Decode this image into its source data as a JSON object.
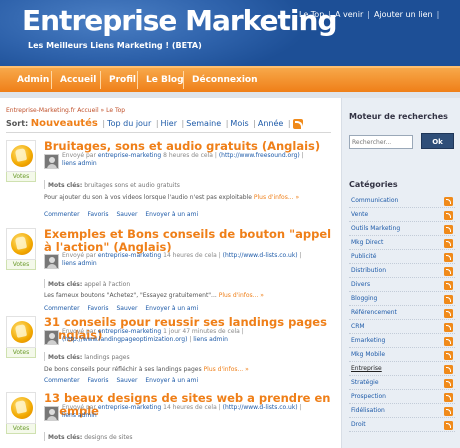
{
  "header": {
    "site_title": "Entreprise Marketing",
    "tagline": "Les Meilleurs Liens Marketing ! (BETA)",
    "top_links": [
      "Le Top",
      "A venir",
      "Ajouter un lien"
    ]
  },
  "nav": {
    "items": [
      "Admin",
      "Accueil",
      "Profil",
      "Le Blog",
      "Déconnexion"
    ]
  },
  "breadcrumb": {
    "home": "Entreprise-Marketing.fr Accueil",
    "sep": "»",
    "current": "Le Top"
  },
  "sort": {
    "label": "Sort:",
    "active": "Nouveautés",
    "options": [
      "Top du jour",
      "Hier",
      "Semaine",
      "Mois",
      "Année"
    ]
  },
  "stories": [
    {
      "title": "Bruitages, sons et audio gratuits (Anglais)",
      "vote_label": "Votes",
      "meta_line1_prefix": "Envoyé par",
      "meta_user": "entreprise-marketing",
      "meta_time": "8 heures de cela",
      "meta_url": "(http://www.freesound.org)",
      "meta_admin": "liens admin",
      "tags_label": "Mots clés:",
      "tags": "bruitages sons et audio gratuits",
      "desc": "Pour ajouter du son à vos videos lorsque l'audio n'est pas exploitable",
      "more": "Plus d'infos... »",
      "actions": [
        "Commenter",
        "Favoris",
        "Sauver",
        "Envoyer à un ami"
      ]
    },
    {
      "title": "Exemples et Bons conseils de bouton \"appel à l'action\" (Anglais)",
      "vote_label": "Votes",
      "meta_line1_prefix": "Envoyé par",
      "meta_user": "entreprise-marketing",
      "meta_time": "14 heures de cela",
      "meta_url": "(http://www.d-lists.co.uk)",
      "meta_admin": "liens admin",
      "tags_label": "Mots clés:",
      "tags": "appel à l'action",
      "desc": "Les fameux boutons \"Achetez\", \"Essayez gratuitement\"...",
      "more": "Plus d'infos... »",
      "actions": [
        "Commenter",
        "Favoris",
        "Sauver",
        "Envoyer à un ami"
      ]
    },
    {
      "title": "31 conseils pour reussir ses landings pages (Anglais)",
      "vote_label": "Votes",
      "meta_line1_prefix": "Envoyé par",
      "meta_user": "entreprise-marketing",
      "meta_time": "1 jour 47 minutes de cela",
      "meta_url": "(http://www.landingpageoptimization.org)",
      "meta_admin": "liens admin",
      "tags_label": "Mots clés:",
      "tags": "landings pages",
      "desc": "De bons conseils pour réfléchir à ses landings pages",
      "more": "Plus d'infos... »",
      "actions": [
        "Commenter",
        "Favoris",
        "Sauver",
        "Envoyer à un ami"
      ]
    },
    {
      "title": "13 beaux designs de sites web a prendre en exemple",
      "vote_label": "Votes",
      "meta_line1_prefix": "Envoyé par",
      "meta_user": "entreprise-marketing",
      "meta_time": "14 heures de cela",
      "meta_url": "(http://www.d-lists.co.uk)",
      "meta_admin": "liens admin",
      "tags_label": "Mots clés:",
      "tags": "designs de sites"
    }
  ],
  "sidebar": {
    "search_title": "Moteur de recherches",
    "search_placeholder": "Rechercher...",
    "ok_label": "Ok",
    "categories_title": "Catégories",
    "categories": [
      "Communication",
      "Vente",
      "Outils Marketing",
      "Mkg Direct",
      "Publicité",
      "Distribution",
      "Divers",
      "Blogging",
      "Référencement",
      "CRM",
      "Emarketing",
      "Mkg Mobile",
      "Entreprise",
      "Stratégie",
      "Prospection",
      "Fidélisation",
      "Droit"
    ],
    "selected_category": "Entreprise"
  },
  "colors": {
    "header_blue": "#1d4f96",
    "nav_orange": "#ef7f18",
    "title_orange": "#ef7f18",
    "link_blue": "#1d5aa8",
    "sidebar_bg": "#e9eef4"
  }
}
